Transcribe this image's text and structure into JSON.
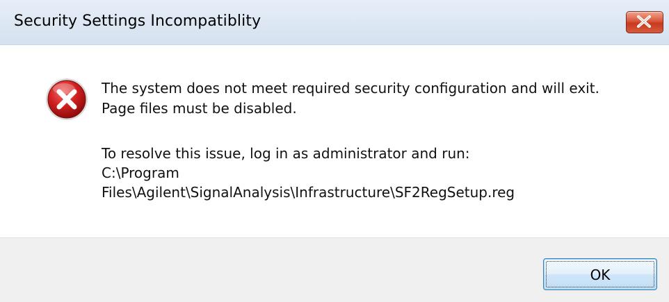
{
  "window": {
    "title": "Security Settings Incompatiblity",
    "close_icon": "close-icon"
  },
  "message": {
    "icon": "error-icon",
    "line1": "The system does not meet required security configuration and will exit.",
    "line2": "Page files must be disabled.",
    "line3": "To resolve this issue, log in as administrator and run:",
    "line4": "C:\\Program",
    "line5": "Files\\Agilent\\SignalAnalysis\\Infrastructure\\SF2RegSetup.reg"
  },
  "buttons": {
    "ok_label": "OK"
  },
  "colors": {
    "titlebar": "#dce6f3",
    "close_button": "#c73a1f",
    "error_icon": "#c8102e",
    "footer": "#f0f0f0"
  }
}
